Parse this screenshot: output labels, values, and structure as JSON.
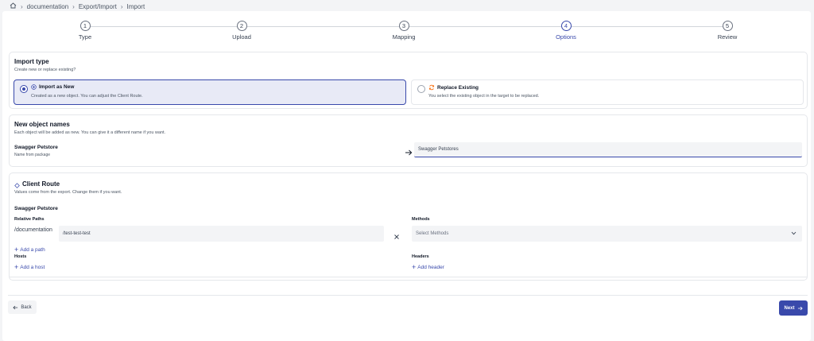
{
  "breadcrumb": {
    "items": [
      "documentation",
      "Export/Import",
      "Import"
    ]
  },
  "stepper": {
    "steps": [
      {
        "num": "1",
        "label": "Type"
      },
      {
        "num": "2",
        "label": "Upload"
      },
      {
        "num": "3",
        "label": "Mapping"
      },
      {
        "num": "4",
        "label": "Options"
      },
      {
        "num": "5",
        "label": "Review"
      }
    ],
    "active_step": "Options"
  },
  "import_type": {
    "title": "Import type",
    "subtitle": "Create new or replace existing?",
    "options": [
      {
        "title": "Import as New",
        "desc": "Created as a new object. You can adjust the Client Route.",
        "selected": true
      },
      {
        "title": "Replace Existing",
        "desc": "You select the existing object in the target to be replaced.",
        "selected": false
      }
    ]
  },
  "names": {
    "title": "New object names",
    "subtitle": "Each object will be added as new. You can give it a different name if you want.",
    "source_name": "Swagger Petstore",
    "source_sub": "Name from package",
    "new_name": "Swagger Petstores"
  },
  "client_route": {
    "title": "Client Route",
    "subtitle": "Values come from the export. Change them if you want.",
    "object_name": "Swagger Petstore",
    "paths_label": "Relative Paths",
    "path_prefix": "/documentation",
    "path_value": "/test-test-test",
    "methods_label": "Methods",
    "methods_placeholder": "Select Methods",
    "add_path": "Add a path",
    "hosts_label": "Hosts",
    "add_host": "Add a host",
    "headers_label": "Headers",
    "add_header": "Add header"
  },
  "footer": {
    "back_label": "Back",
    "next_label": "Next"
  },
  "colors": {
    "accent": "#3949ab",
    "selected_bg": "#e8eaf6",
    "replace_icon": "#f97316"
  },
  "icons": {
    "home": "home-icon",
    "chevron": "chevron-right-icon",
    "plus_circle": "plus-circle-icon",
    "refresh": "refresh-icon",
    "arrow_right": "arrow-right-icon",
    "clear": "close-icon",
    "dropdown": "chevron-down-icon",
    "route": "route-icon"
  }
}
